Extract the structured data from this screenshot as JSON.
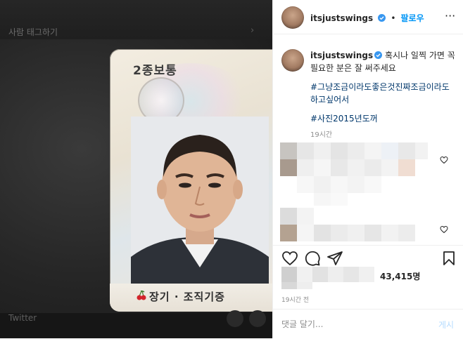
{
  "photo": {
    "tag_label": "사람 태그하기",
    "source_label": "Twitter",
    "card": {
      "license_class": "2종보통",
      "donor_text": "장기 · 조직기증"
    }
  },
  "header": {
    "username": "itsjustswings",
    "separator": "•",
    "follow_label": "팔로우",
    "more": "···"
  },
  "caption": {
    "username": "itsjustswings",
    "text": "혹시나 일찍 가면 꼭 필요한 분은 잘 써주세요",
    "hashtag_1": "#그냥조금이라도좋은것진짜조금이라도하고싶어서",
    "hashtag_2": "#사진2015년도꺼",
    "time": "19시간"
  },
  "likes": {
    "count": "43,415",
    "unit": "명"
  },
  "post_time": "19시간 전",
  "comment": {
    "placeholder": "댓글 달기...",
    "post_label": "게시"
  },
  "colors": {
    "follow_blue": "#0095f6",
    "hashtag_blue": "#00376b",
    "verified_blue": "#3897f0",
    "post_disabled": "#b3dbff"
  },
  "icons": {
    "like": "heart-icon",
    "comment": "comment-bubble-icon",
    "share": "paper-plane-icon",
    "save": "bookmark-icon"
  }
}
